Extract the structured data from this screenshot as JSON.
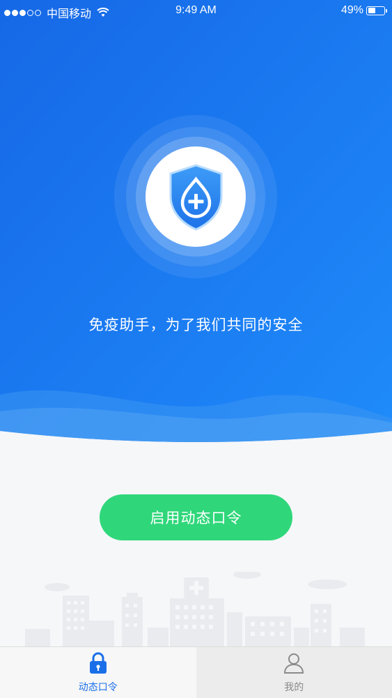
{
  "status_bar": {
    "carrier": "中国移动",
    "time": "9:49 AM",
    "battery_percent": "49%",
    "battery_level": 0.49,
    "signal_bars_full": 3,
    "signal_bars_total": 5
  },
  "hero": {
    "slogan": "免疫助手，为了我们共同的安全",
    "icon": "shield-medical-icon"
  },
  "actions": {
    "enable_label": "启用动态口令"
  },
  "tab_bar": {
    "tabs": [
      {
        "label": "动态口令",
        "icon": "lock-icon",
        "active": true
      },
      {
        "label": "我的",
        "icon": "user-icon",
        "active": false
      }
    ]
  },
  "colors": {
    "hero_blue": "#1a7bf0",
    "button_green": "#2fd77a",
    "active_tab": "#1a6fe8",
    "inactive_tab": "#8a8a8a"
  }
}
